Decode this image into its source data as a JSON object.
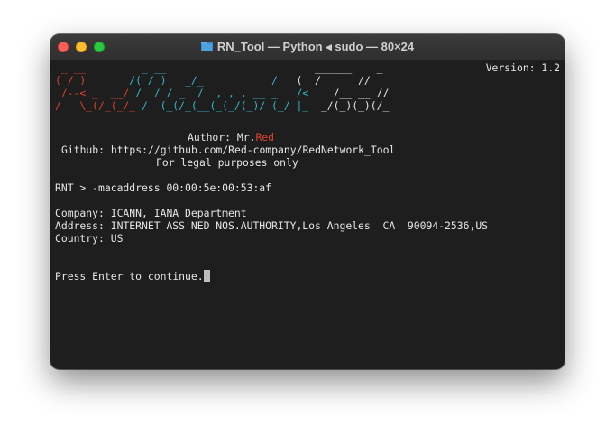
{
  "window": {
    "title": "RN_Tool — Python ◂ sudo — 80×24"
  },
  "terminal": {
    "version": "Version: 1.2",
    "banner": {
      "line1": {
        "red": " _ __         ",
        "cyan": "_ __       ",
        "white": "                 ______    _"
      },
      "line2": {
        "red": "( / )       ",
        "cyan": "/( / )   _/_           /  ",
        "white": " (  /      //"
      },
      "line3": {
        "red": " /--< _  __/ ",
        "cyan": "/  / / _  /  , , , __ _   /<    ",
        "white": "/__ __ //"
      },
      "line4": {
        "red": "/   \\_(/_(_/_ ",
        "cyan": "/  (_(/_(__(_(_/(_)/ (_/ |_ ",
        "white": " _/(_)(_)(/_"
      }
    },
    "author_label": "Author: Mr.",
    "author_name": "Red",
    "github_line": "Github: https://github.com/Red-company/RedNetwork_Tool",
    "legal_line": "For legal purposes only",
    "prompt": "RNT > -macaddress 00:00:5e:00:53:af",
    "company": "Company: ICANN, IANA Department",
    "address": "Address: INTERNET ASS'NED NOS.AUTHORITY,Los Angeles  CA  90094-2536,US",
    "country": "Country: US",
    "continue_prompt": "Press Enter to continue."
  }
}
